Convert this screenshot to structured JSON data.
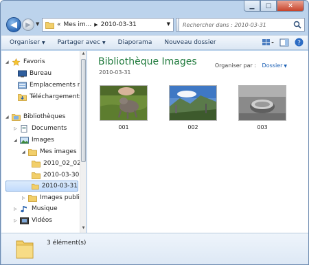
{
  "nav": {
    "breadcrumb": [
      "«",
      "Mes im...",
      "2010-03-31"
    ],
    "search_placeholder": "Rechercher dans : 2010-03-31"
  },
  "toolbar": {
    "items": [
      "Organiser",
      "Partager avec",
      "Diaporama",
      "Nouveau dossier"
    ]
  },
  "tree": {
    "favoris": "Favoris",
    "bureau": "Bureau",
    "emplacements": "Emplacements ré",
    "telechargements": "Téléchargements",
    "bibliotheques": "Bibliothèques",
    "documents": "Documents",
    "images": "Images",
    "mes_images": "Mes images",
    "f1": "2010_02_02",
    "f2": "2010-03-30",
    "f3": "2010-03-31",
    "images_publiques": "Images publiques",
    "musique": "Musique",
    "videos": "Vidéos"
  },
  "content": {
    "title": "Bibliothèque Images",
    "subtitle": "2010-03-31",
    "arrange_label": "Organiser par :",
    "arrange_value": "Dossier",
    "items": [
      {
        "name": "001"
      },
      {
        "name": "002"
      },
      {
        "name": "003"
      }
    ]
  },
  "details": {
    "count": "3 élément(s)"
  },
  "colors": {
    "title_green": "#1f7a3c",
    "link_blue": "#1a5fb4",
    "chrome_blue": "#bcd3ec"
  }
}
